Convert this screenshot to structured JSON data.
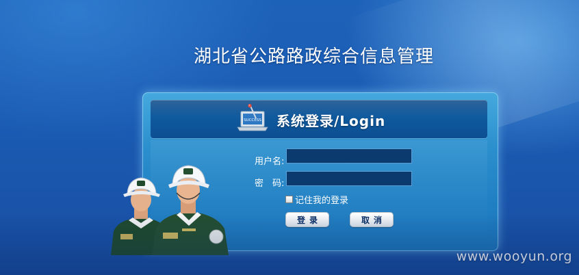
{
  "site": {
    "title": "湖北省公路路政综合信息管理"
  },
  "login_panel": {
    "heading": "系统登录/Login",
    "icon": "laptop-success-icon",
    "icon_screen_text": "SUCCESS",
    "username_label": "用户名:",
    "username_value": "",
    "password_label": "密　码:",
    "password_value": "",
    "remember_label": "记住我的登录",
    "remember_checked": false,
    "login_button": "登录",
    "cancel_button": "取消"
  },
  "illustration": {
    "subject": "two-traffic-officers-image"
  },
  "watermark": {
    "text": "www.wooyun.org"
  },
  "colors": {
    "background": "#1b5cb4",
    "panel": "#2c8fcd",
    "header_bar": "#0f5a9e",
    "input_fill": "#0b3a6e",
    "button_text": "#0b2f66"
  }
}
